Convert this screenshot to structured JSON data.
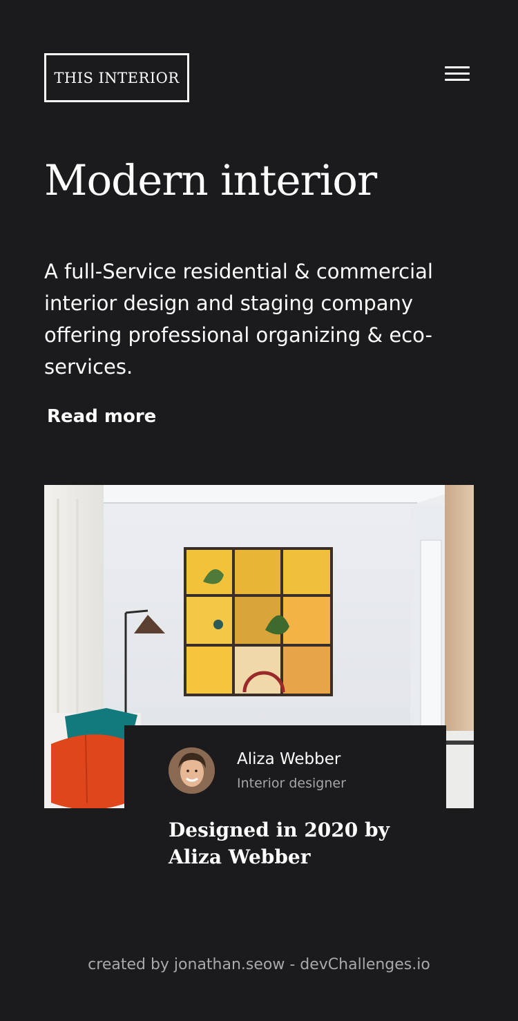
{
  "header": {
    "logo_text": "THIS INTERIOR",
    "menu_icon": "hamburger-menu-icon"
  },
  "hero": {
    "title": "Modern interior",
    "description": "A full-Service residential & commercial interior design and staging company offering professional organizing & eco-services.",
    "read_more_label": "Read more"
  },
  "author_card": {
    "name": "Aliza Webber",
    "role": "Interior designer",
    "avatar_icon": "avatar-photo"
  },
  "caption": {
    "designed_text": "Designed in 2020 by Aliza Webber"
  },
  "footer": {
    "credit": "created by jonathan.seow - devChallenges.io"
  },
  "colors": {
    "background": "#1b1a1d",
    "text": "#ffffff",
    "muted": "#a6a6a9"
  }
}
